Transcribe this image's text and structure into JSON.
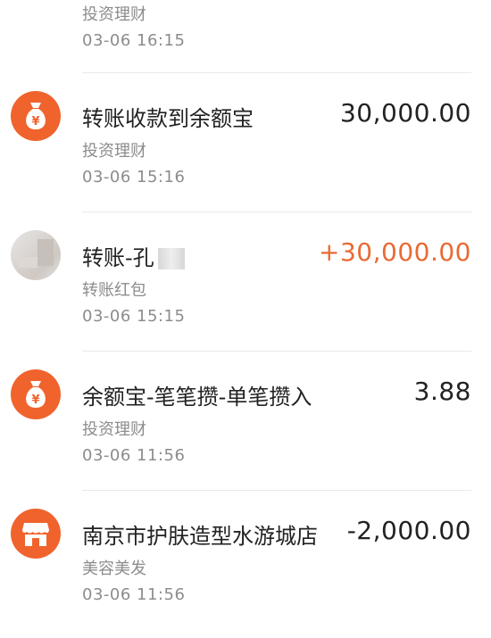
{
  "transactions": [
    {
      "category": "投资理财",
      "time": "03-06  16:15"
    },
    {
      "icon": "money-bag-icon",
      "title": "转账收款到余额宝",
      "category": "投资理财",
      "time": "03-06  15:16",
      "amount": "30,000.00"
    },
    {
      "icon": "contact-photo",
      "title": "转账-孔",
      "category": "转账红包",
      "time": "03-06  15:15",
      "amount": "+30,000.00"
    },
    {
      "icon": "money-bag-icon",
      "title": "余额宝-笔笔攒-单笔攒入",
      "category": "投资理财",
      "time": "03-06  11:56",
      "amount": "3.88"
    },
    {
      "icon": "store-icon",
      "title": "南京市护肤造型水游城店",
      "category": "美容美发",
      "time": "03-06  11:56",
      "amount": "-2,000.00"
    }
  ],
  "colors": {
    "accent": "#f0632c",
    "income": "#e96a34",
    "secondary_text": "#8c8c8c"
  }
}
